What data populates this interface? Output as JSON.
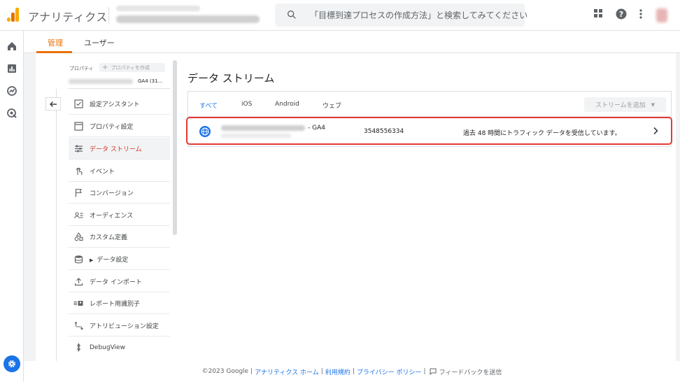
{
  "header": {
    "app_title": "アナリティクス",
    "search_placeholder": "「目標到達プロセスの作成方法」と検索してみてください"
  },
  "tabs": [
    {
      "label": "管理",
      "active": true
    },
    {
      "label": "ユーザー",
      "active": false
    }
  ],
  "property": {
    "label": "プロパティ",
    "create_label": "プロパティを作成",
    "name": "GA4 (31..."
  },
  "menu": [
    {
      "label": "設定アシスタント",
      "icon": "checkbox-icon",
      "active": false
    },
    {
      "label": "プロパティ設定",
      "icon": "window-icon",
      "active": false
    },
    {
      "label": "データ ストリーム",
      "icon": "stream-icon",
      "active": true
    },
    {
      "label": "イベント",
      "icon": "touch-icon",
      "active": false
    },
    {
      "label": "コンバージョン",
      "icon": "flag-icon",
      "active": false
    },
    {
      "label": "オーディエンス",
      "icon": "audience-icon",
      "active": false
    },
    {
      "label": "カスタム定義",
      "icon": "shapes-icon",
      "active": false
    },
    {
      "label": "データ設定",
      "icon": "database-icon",
      "active": false
    },
    {
      "label": "データ インポート",
      "icon": "upload-icon",
      "active": false
    },
    {
      "label": "レポート用識別子",
      "icon": "id-icon",
      "active": false
    },
    {
      "label": "アトリビューション設定",
      "icon": "attribution-icon",
      "active": false
    },
    {
      "label": "DebugView",
      "icon": "debug-icon",
      "active": false
    }
  ],
  "main": {
    "title": "データ ストリーム",
    "filters": [
      {
        "label": "すべて",
        "active": true
      },
      {
        "label": "iOS",
        "active": false
      },
      {
        "label": "Android",
        "active": false
      },
      {
        "label": "ウェブ",
        "active": false
      }
    ],
    "add_stream_label": "ストリームを追加",
    "stream": {
      "name_suffix": "- GA4",
      "id": "3548556334",
      "status": "過去 48 時間にトラフィック データを受信しています。"
    }
  },
  "footer": {
    "copyright": "©2023 Google",
    "links": [
      "アナリティクス ホーム",
      "利用規約",
      "プライバシー ポリシー"
    ],
    "feedback": "フィードバックを送信"
  },
  "colors": {
    "accent_blue": "#1a73e8",
    "tab_active": "#e8710a",
    "menu_active": "#d93025",
    "highlight_border": "#e53935"
  }
}
